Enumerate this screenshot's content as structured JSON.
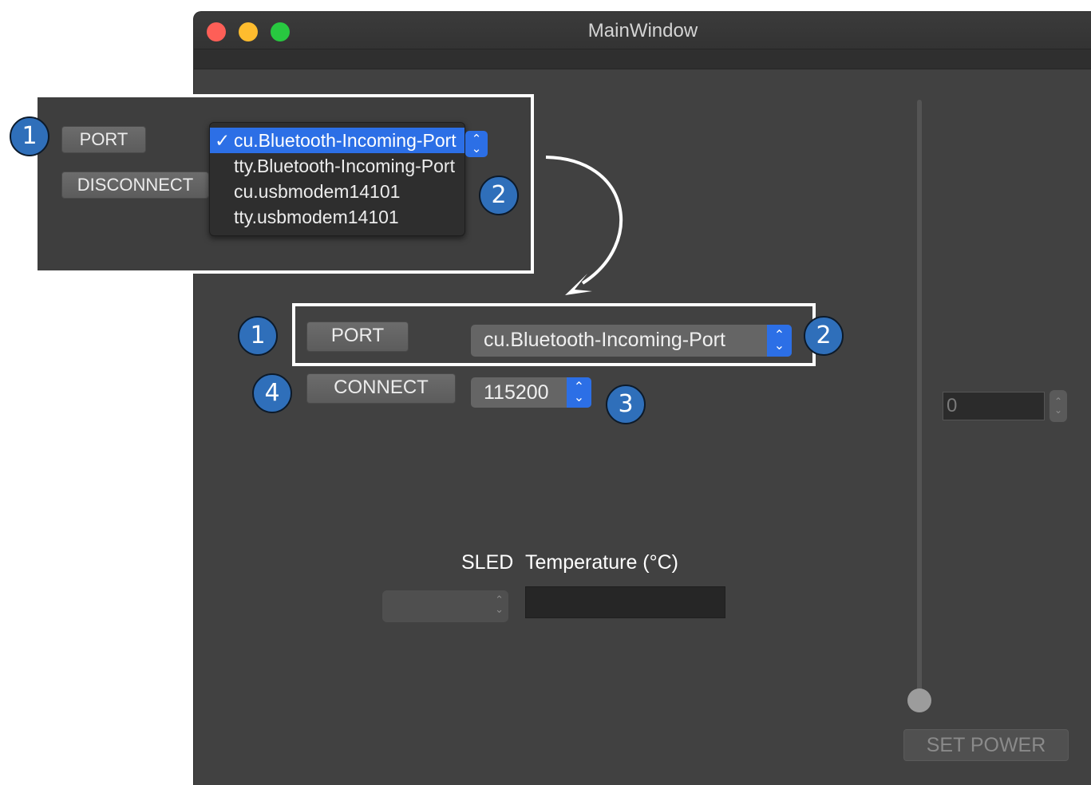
{
  "window": {
    "title": "MainWindow"
  },
  "main": {
    "port_button": "PORT",
    "connect_button": "CONNECT",
    "port_select_value": "cu.Bluetooth-Incoming-Port",
    "baud_select_value": "115200",
    "sled_label": "SLED",
    "temperature_label": "Temperature (°C)",
    "power_value": "0",
    "set_power_button": "SET POWER"
  },
  "inset": {
    "port_button": "PORT",
    "disconnect_button": "DISCONNECT",
    "dropdown_options": [
      {
        "label": "cu.Bluetooth-Incoming-Port",
        "selected": true
      },
      {
        "label": "tty.Bluetooth-Incoming-Port",
        "selected": false
      },
      {
        "label": "cu.usbmodem14101",
        "selected": false
      },
      {
        "label": "tty.usbmodem14101",
        "selected": false
      }
    ],
    "check_mark": "✓"
  },
  "badges": {
    "inset_port": "1",
    "inset_dropdown": "2",
    "port": "1",
    "port_select": "2",
    "baud": "3",
    "connect": "4"
  },
  "colors": {
    "badge": "#2f6fba",
    "select_accent": "#2c6fe6",
    "window_bg": "#414141"
  }
}
